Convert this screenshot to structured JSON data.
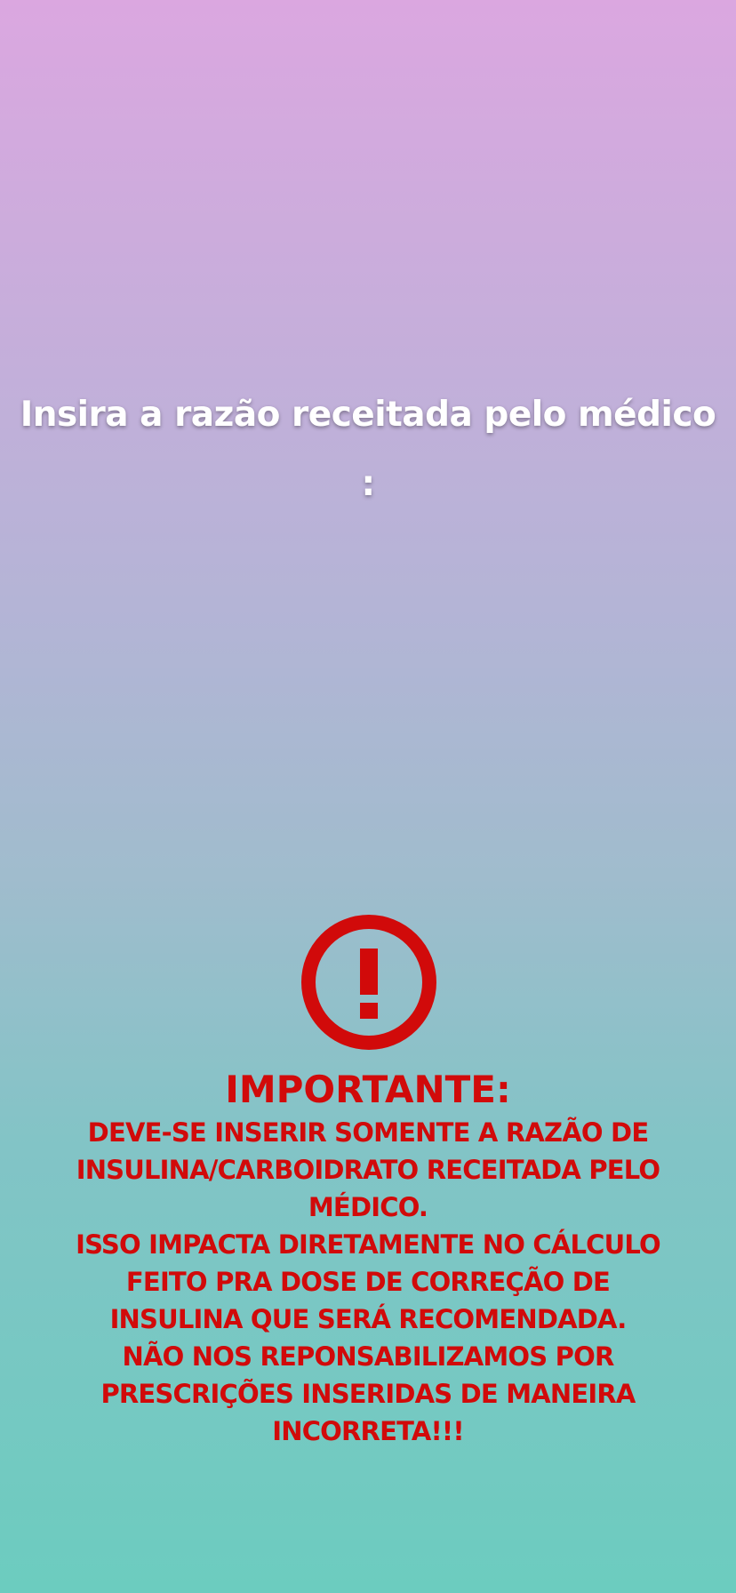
{
  "prompt": {
    "line1": "Insira a razão receitada pelo médico",
    "line2": ":"
  },
  "warning": {
    "icon": "exclamation-circle-icon",
    "icon_color": "#d10a0a",
    "title": "IMPORTANTE:",
    "paragraphs": [
      "DEVE-SE INSERIR SOMENTE A RAZÃO DE INSULINA/CARBOIDRATO RECEITADA PELO MÉDICO.",
      "ISSO IMPACTA DIRETAMENTE NO CÁLCULO FEITO PRA DOSE DE CORREÇÃO DE INSULINA QUE SERÁ RECOMENDADA.",
      "NÃO NOS REPONSABILIZAMOS POR PRESCRIÇÕES INSERIDAS DE MANEIRA INCORRETA!!!"
    ]
  },
  "colors": {
    "gradient_top": "#dba7e0",
    "gradient_bottom": "#6cccbf",
    "warning_red": "#d10a0a",
    "prompt_text": "#ffffff"
  }
}
